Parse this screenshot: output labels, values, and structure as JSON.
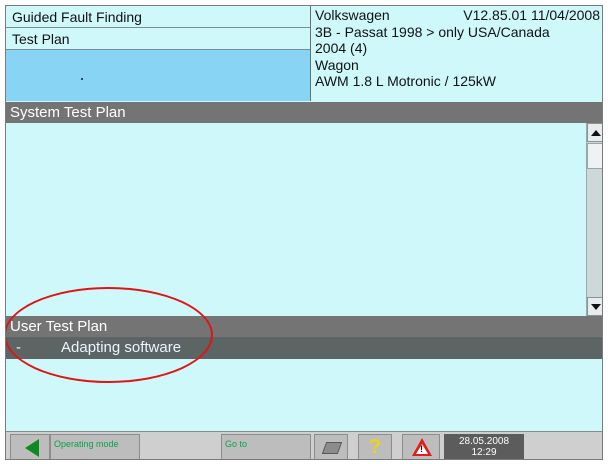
{
  "header": {
    "module_title": "Guided Fault Finding",
    "mode_title": "Test Plan",
    "vehicle": {
      "make": "Volkswagen",
      "version": "V12.85.01 11/04/2008",
      "model": "3B - Passat 1998 > only USA/Canada",
      "year": "2004 (4)",
      "body": "Wagon",
      "engine": "AWM 1.8 L Motronic / 125kW"
    }
  },
  "system_test_plan": {
    "title": "System Test Plan"
  },
  "user_test_plan": {
    "title": "User Test Plan",
    "items": [
      {
        "bullet": "-",
        "label": "Adapting software"
      }
    ]
  },
  "toolbar": {
    "operating_mode_label": "Operating mode",
    "goto_label": "Go to",
    "date": "28.05.2008",
    "time": "12:29"
  },
  "colors": {
    "background": "#cff8fb",
    "section_bar": "#747474",
    "highlight": "#88d4f4",
    "annotation": "#e01414"
  }
}
